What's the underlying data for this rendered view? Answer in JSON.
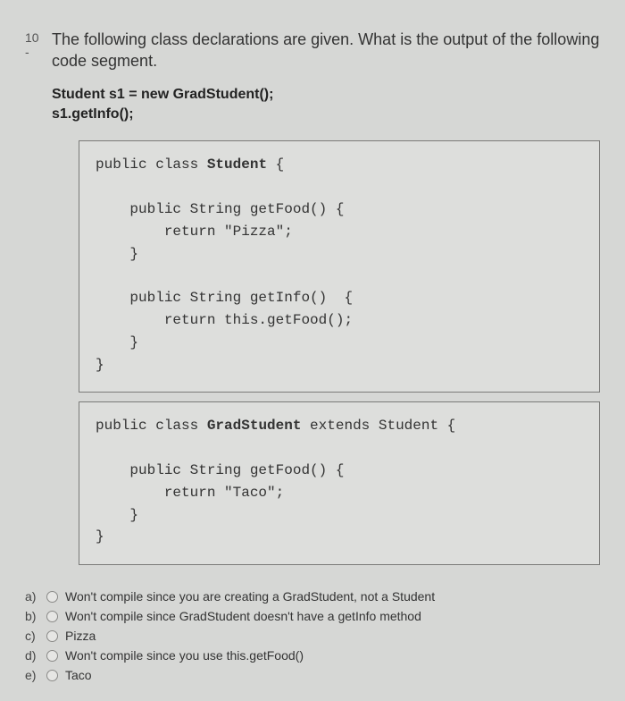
{
  "question": {
    "number": "10 -",
    "text": "The following class declarations are given. What is the output of the following code segment.",
    "code_prompt_line1": "Student s1 = new GradStudent();",
    "code_prompt_line2": "s1.getInfo();"
  },
  "codebox1": {
    "l1a": "public class ",
    "l1b": "Student",
    "l1c": " {",
    "l2": "    public String getFood() {",
    "l3": "        return \"Pizza\";",
    "l4": "    }",
    "l5": "    public String getInfo()  {",
    "l6": "        return this.getFood();",
    "l7": "    }",
    "l8": "}"
  },
  "codebox2": {
    "l1a": "public class ",
    "l1b": "GradStudent",
    "l1c": " extends Student {",
    "l2": "    public String getFood() {",
    "l3": "        return \"Taco\";",
    "l4": "    }",
    "l5": "}"
  },
  "answers": {
    "a": {
      "letter": "a)",
      "text": "Won't compile since you are creating a GradStudent, not a Student"
    },
    "b": {
      "letter": "b)",
      "text": "Won't compile since GradStudent doesn't have a getInfo method"
    },
    "c": {
      "letter": "c)",
      "text": "Pizza"
    },
    "d": {
      "letter": "d)",
      "text": "Won't compile since you use this.getFood()"
    },
    "e": {
      "letter": "e)",
      "text": "Taco"
    }
  }
}
